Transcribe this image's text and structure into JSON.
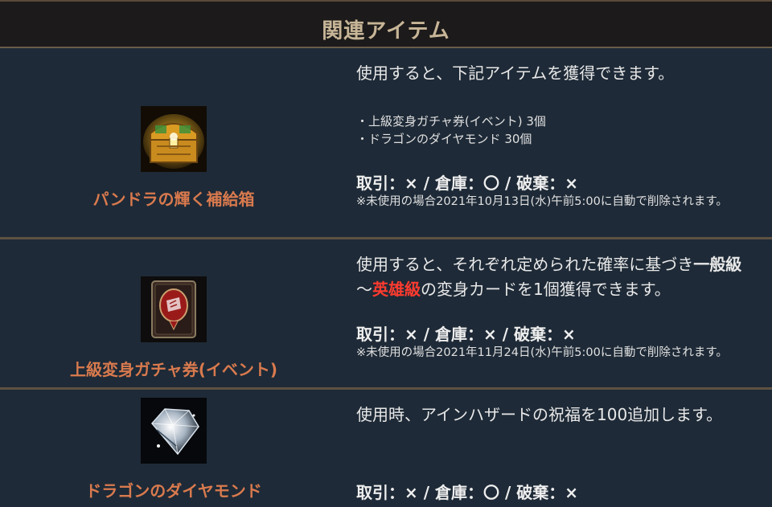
{
  "header": {
    "title": "関連アイテム"
  },
  "items": [
    {
      "name": "パンドラの輝く補給箱",
      "icon": "treasure-chest-icon",
      "description": "使用すると、下記アイテムを獲得できます。",
      "sub_items": [
        "・上級変身ガチャ券(イベント) 3個",
        "・ドラゴンのダイヤモンド 30個"
      ],
      "trade": "取引：× / 倉庫：〇 / 破棄：×",
      "note": "※未使用の場合2021年10月13日(水)午前5:00に自動で削除されます。"
    },
    {
      "name": "上級変身ガチャ券(イベント)",
      "icon": "transform-card-icon",
      "description_part1": "使用すると、それぞれ定められた確率に基づき",
      "description_normal": "一般級",
      "description_tilde": "～",
      "description_hero": "英雄級",
      "description_part2": "の変身カードを1個獲得できます。",
      "trade": "取引：× / 倉庫：× / 破棄：×",
      "note": "※未使用の場合2021年11月24日(水)午前5:00に自動で削除されます。"
    },
    {
      "name": "ドラゴンのダイヤモンド",
      "icon": "diamond-icon",
      "description": "使用時、アインハザードの祝福を100追加します。",
      "trade": "取引：× / 倉庫：〇 / 破棄：×"
    }
  ],
  "colors": {
    "header_text": "#c7b597",
    "item_name": "#d97a4e",
    "hero": "#ff3b2f",
    "background": "#1e2a37"
  }
}
